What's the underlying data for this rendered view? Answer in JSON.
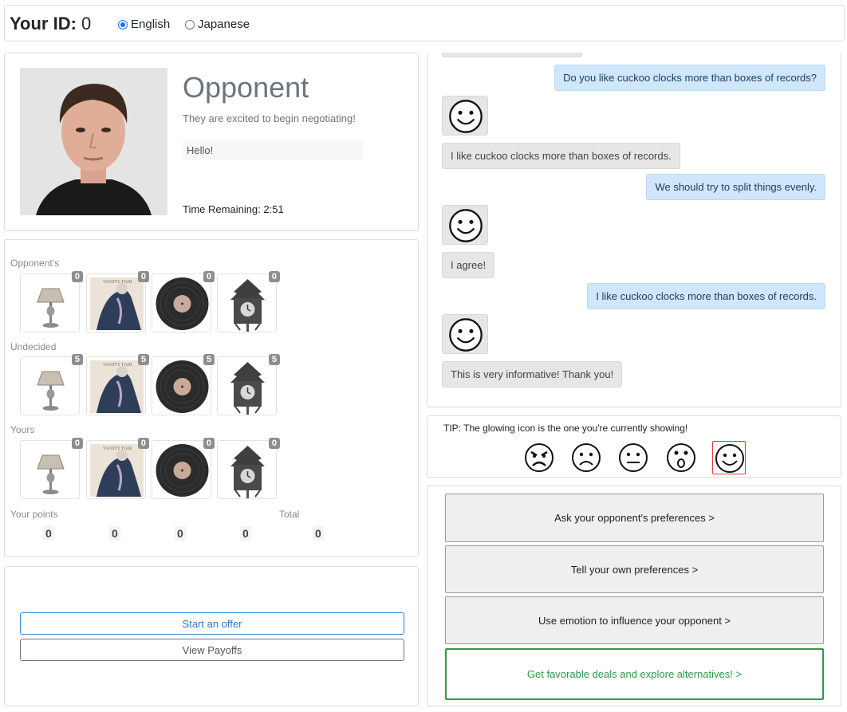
{
  "header": {
    "id_label": "Your ID:",
    "id_value": "0",
    "languages": [
      {
        "label": "English",
        "selected": true
      },
      {
        "label": "Japanese",
        "selected": false
      }
    ]
  },
  "opponent": {
    "title": "Opponent",
    "status": "They are excited to begin negotiating!",
    "message": "Hello!",
    "timer": "Time Remaining: 2:51"
  },
  "items": {
    "opponents_label": "Opponent's",
    "undecided_label": "Undecided",
    "yours_label": "Yours",
    "names": [
      "lamp-icon",
      "painting-icon",
      "record-icon",
      "cuckoo-clock-icon"
    ],
    "opponents_counts": [
      "0",
      "0",
      "0",
      "0"
    ],
    "undecided_counts": [
      "5",
      "5",
      "5",
      "5"
    ],
    "yours_counts": [
      "0",
      "0",
      "0",
      "0"
    ],
    "points_label": "Your points",
    "total_label": "Total",
    "points": [
      "0",
      "0",
      "0",
      "0"
    ],
    "total": "0"
  },
  "offer": {
    "start_label": "Start an offer",
    "payoffs_label": "View Payoffs"
  },
  "chat": {
    "messages": [
      {
        "from": "me",
        "text": "Do you like cuckoo clocks more than boxes of records?"
      },
      {
        "from": "opp",
        "text": "I like cuckoo clocks more than boxes of records."
      },
      {
        "from": "me",
        "text": "We should try to split things evenly."
      },
      {
        "from": "opp",
        "text": "I agree!"
      },
      {
        "from": "me",
        "text": "I like cuckoo clocks more than boxes of records."
      },
      {
        "from": "opp",
        "text": "This is very informative! Thank you!"
      }
    ],
    "opp_face": "smile-icon"
  },
  "emotions": {
    "tip": "TIP: The glowing icon is the one you're currently showing!",
    "icons": [
      "angry-icon",
      "sad-icon",
      "neutral-icon",
      "surprised-icon",
      "happy-icon"
    ],
    "active": "happy-icon",
    "active_color": "#e03b3b"
  },
  "actions": {
    "ask": "Ask your opponent's preferences >",
    "tell": "Tell your own preferences >",
    "emotion": "Use emotion to influence your opponent >",
    "deals": "Get favorable deals and explore alternatives! >"
  },
  "colors": {
    "accent_blue": "#2b78c6",
    "accent_green": "#2e9b47",
    "my_bubble": "#cfe6fb",
    "opp_bubble": "#e6e6e6"
  }
}
